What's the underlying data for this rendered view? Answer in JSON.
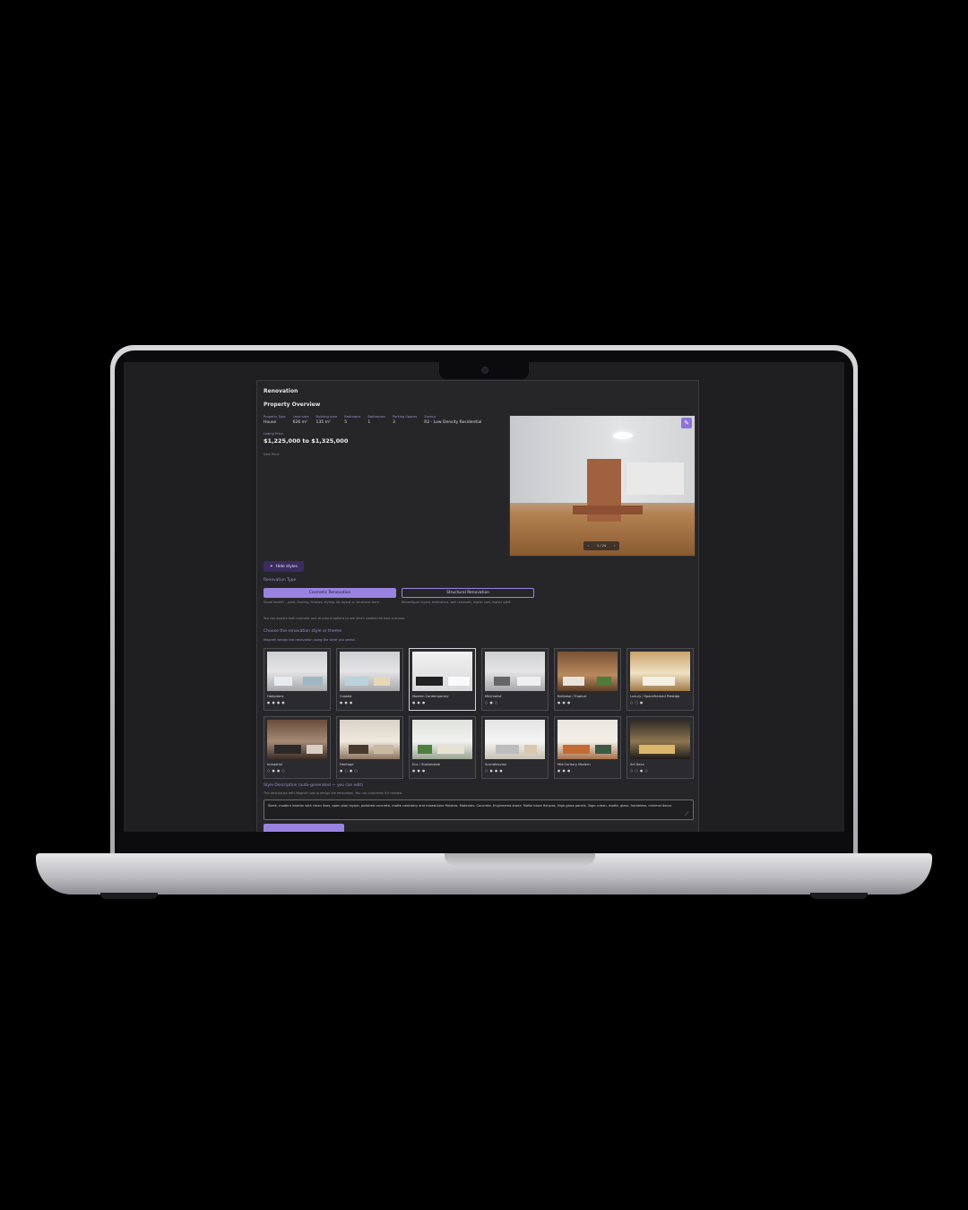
{
  "app": {
    "title": "Renovation",
    "overview_title": "Property Overview"
  },
  "property": {
    "facts": [
      {
        "key": "Property Type",
        "value": "House"
      },
      {
        "key": "Land area",
        "value": "626 m²"
      },
      {
        "key": "Building area",
        "value": "135 m²"
      },
      {
        "key": "Bedrooms",
        "value": "5"
      },
      {
        "key": "Bathrooms",
        "value": "1"
      },
      {
        "key": "Parking Spaces",
        "value": "3"
      },
      {
        "key": "Zoning",
        "value": "R2 - Low Density Residential"
      }
    ],
    "listing_price_label": "Listing Price",
    "listing_price": "$1,225,000 to $1,325,000",
    "sale_price_label": "Sale Price"
  },
  "photo": {
    "edit_icon": "pencil-icon",
    "pager_text": "1 / 24",
    "prev": "‹",
    "next": "›"
  },
  "controls": {
    "hide_styles_label": "Hide styles",
    "renovation_type_label": "Renovation Type",
    "cosmetic_label": "Cosmetic Renovation",
    "cosmetic_desc": "Visual facelift – paint, flooring, finishes, styling. No layout or structural work.",
    "structural_label": "Structural Renovation",
    "structural_desc": "Reconfigure layout, extensions, wall removals, higher cost, higher uplift.",
    "note": "You can explore both cosmetic and structural options to see which creates the best outcome.",
    "choose_title": "Choose the renovation style or theme",
    "choose_sub": "Magnell design the renovation using the style you select."
  },
  "styles": [
    {
      "label": "Hamptons",
      "dots": "● ● ● ●",
      "selected": false
    },
    {
      "label": "Coastal",
      "dots": "● ● ●",
      "selected": false
    },
    {
      "label": "Modern Contemporary",
      "dots": "● ● ●",
      "selected": true
    },
    {
      "label": "Minimalist",
      "dots": "○ ● ○",
      "selected": false
    },
    {
      "label": "Balinese / Tropical",
      "dots": "● ● ●",
      "selected": false
    },
    {
      "label": "Luxury / Spaceframed Prestige",
      "dots": "○ ○ ●",
      "selected": false
    },
    {
      "label": "Industrial",
      "dots": "○ ● ● ○",
      "selected": false
    },
    {
      "label": "Heritage",
      "dots": "● ○ ● ○",
      "selected": false
    },
    {
      "label": "Eco / Sustainable",
      "dots": "● ● ●",
      "selected": false
    },
    {
      "label": "Scandinavian",
      "dots": "○ ● ● ●",
      "selected": false
    },
    {
      "label": "Mid-Century Modern",
      "dots": "● ● ●",
      "selected": false
    },
    {
      "label": "Art Deco",
      "dots": "○ ○ ● ○",
      "selected": false
    }
  ],
  "description": {
    "title": "Style Description (auto-generated — you can edit)",
    "subtitle": "This description tells Magnell how to design the renovation. You can customise it if needed.",
    "text": "Sleek, modern interior with clean lines, open plan layout, polished concrete, matte cabinetry and mixed-tone finishes. Materials: Concrete, Engineered stone, Matte black fixtures, High-gloss panels. Tags: urban, matte, glass, frameless, minimal decor."
  },
  "colors": {
    "accent": "#9a83e0",
    "panel": "#262629",
    "screen": "#1f1f22"
  }
}
